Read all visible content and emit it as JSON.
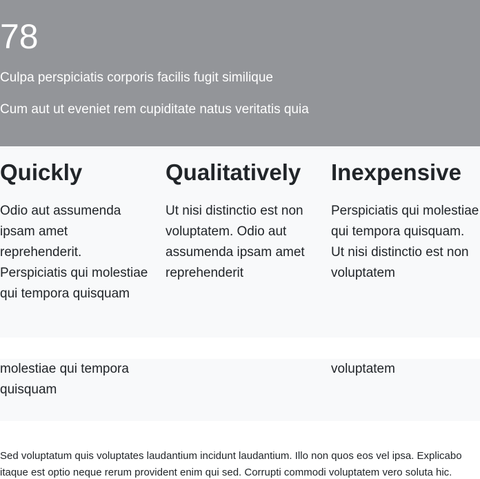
{
  "hero": {
    "number": "78",
    "line1": "Culpa perspiciatis corporis facilis fugit similique",
    "line2": "Cum aut ut eveniet rem cupiditate natus veritatis quia"
  },
  "features": [
    {
      "title": "Quickly",
      "text": "Odio aut assumenda ipsam amet reprehenderit. Perspiciatis qui molestiae qui tempora quisquam"
    },
    {
      "title": "Qualitatively",
      "text": "Ut nisi distinctio est non voluptatem. Odio aut assumenda ipsam amet reprehenderit"
    },
    {
      "title": "Inexpensive",
      "text": "Perspiciatis qui molestiae qui tempora quisquam. Ut nisi distinctio est non voluptatem"
    }
  ],
  "repeated_section": {
    "col1_line1": "molestiae qui tempora",
    "col1_line2": "quisquam",
    "col3_line1": "voluptatem"
  },
  "body_text": "Sed voluptatum quis voluptates laudantium incidunt laudantium. Illo non quos eos vel ipsa. Explicabo itaque est optio neque rerum provident enim qui sed. Corrupti commodi voluptatem vero soluta hic."
}
